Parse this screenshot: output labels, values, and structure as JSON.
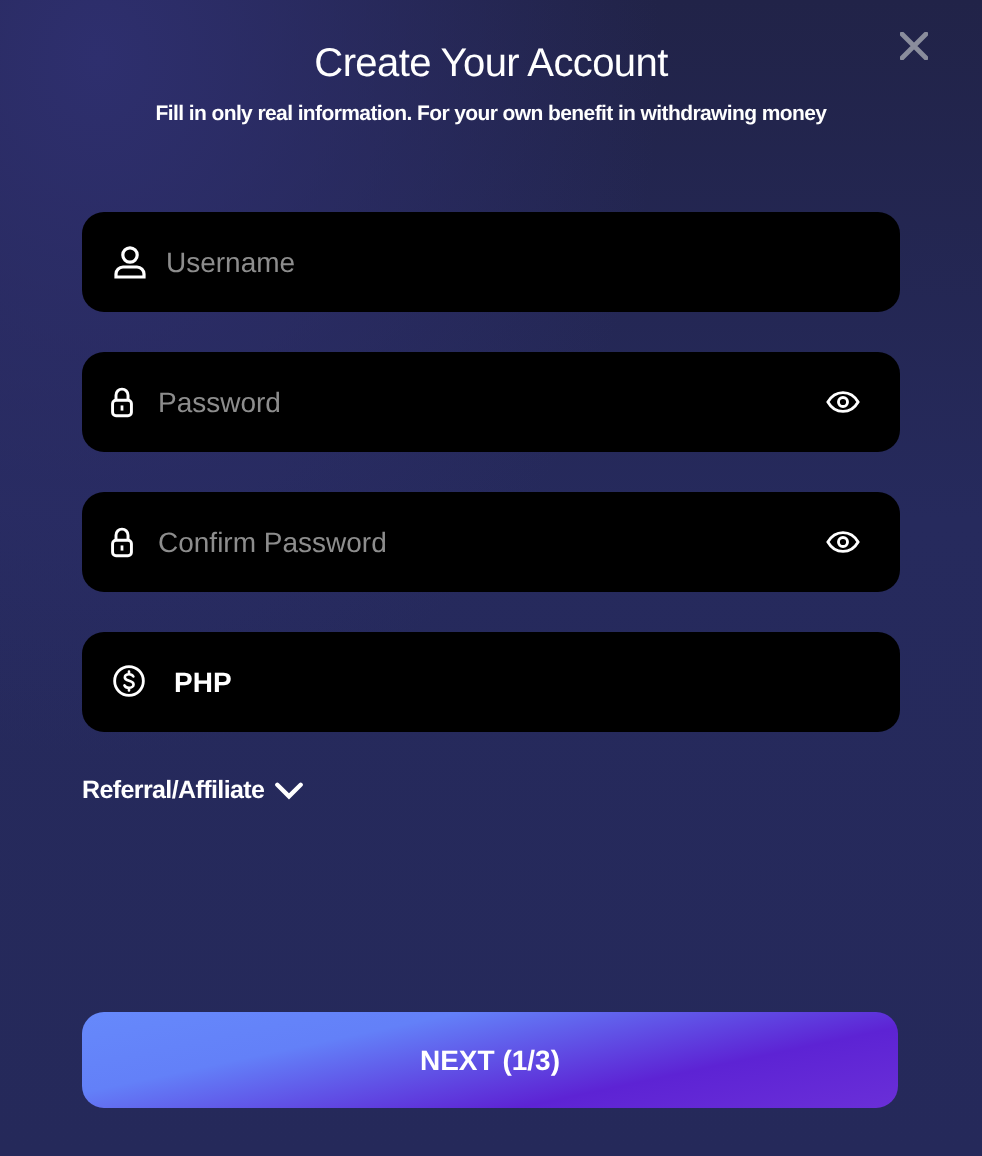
{
  "title": "Create Your Account",
  "subtitle": "Fill in only real information. For your own benefit in withdrawing money",
  "fields": [
    {
      "kind": "user",
      "placeholder": "Username"
    },
    {
      "kind": "password",
      "placeholder": "Password"
    },
    {
      "kind": "password",
      "placeholder": "Confirm Password"
    },
    {
      "kind": "currency",
      "value": "PHP"
    }
  ],
  "referral": {
    "label": "Referral/Affiliate",
    "expanded": false
  },
  "next_button": "NEXT (1/3)"
}
